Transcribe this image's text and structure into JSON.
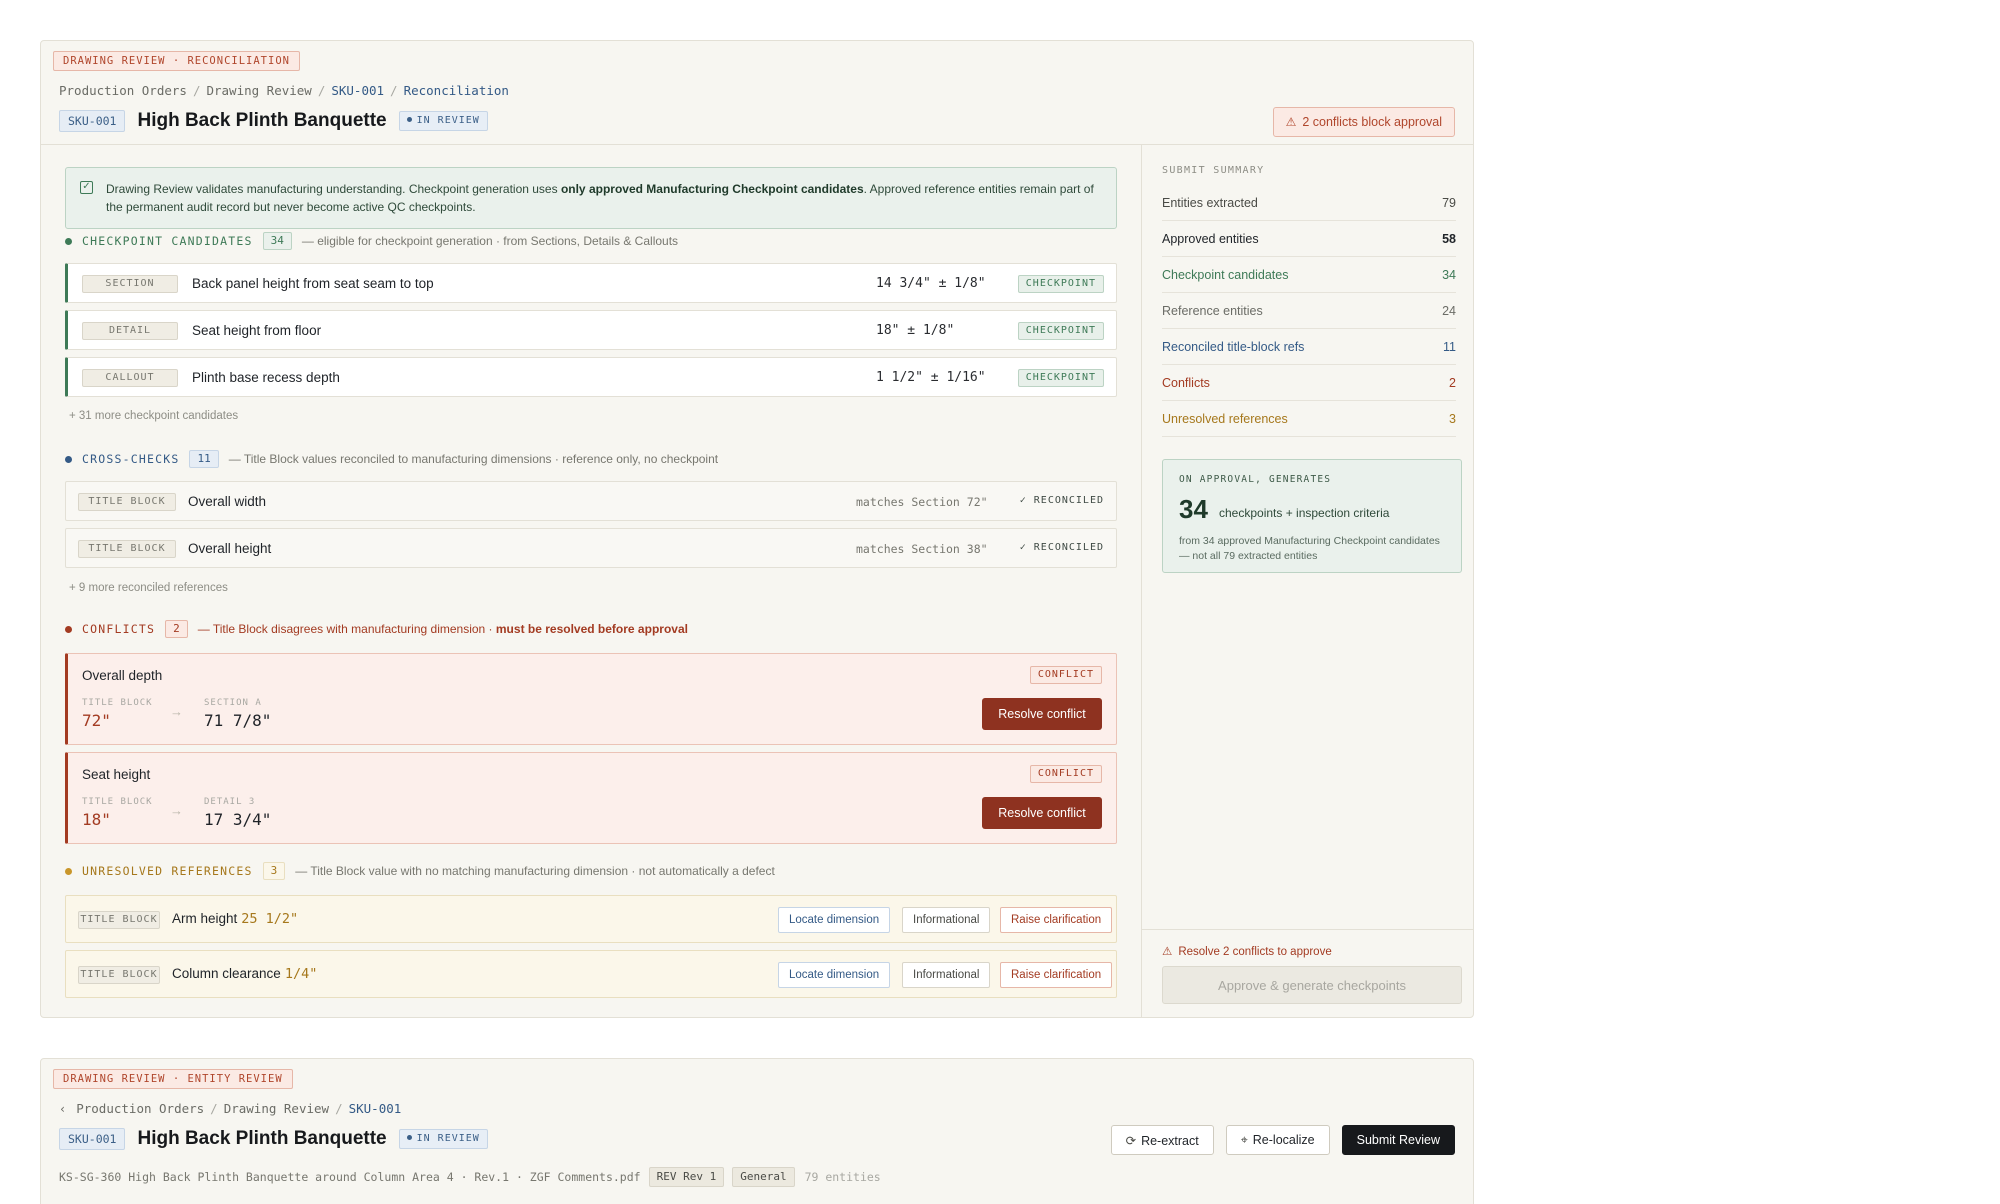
{
  "panel1": {
    "ribbon": "DRAWING REVIEW · RECONCILIATION",
    "breadcrumb": [
      "Production Orders",
      "Drawing Review",
      "SKU-001",
      "Reconciliation"
    ],
    "sku": "SKU-001",
    "title": "High Back Plinth Banquette",
    "status": "IN REVIEW",
    "blocker": "2 conflicts block approval",
    "note": {
      "pre": "Drawing Review validates manufacturing understanding. Checkpoint generation uses ",
      "bold": "only approved Manufacturing Checkpoint candidates",
      "post": ". Approved reference entities remain part of the permanent audit record but never become active QC checkpoints."
    },
    "candidates": {
      "title": "CHECKPOINT CANDIDATES",
      "count": "34",
      "desc": "— eligible for checkpoint generation · from Sections, Details & Callouts",
      "rows": [
        {
          "tag": "SECTION",
          "label": "Back panel height from seat seam to top",
          "value": "14 3/4\" ± 1/8\"",
          "badge": "CHECKPOINT"
        },
        {
          "tag": "DETAIL",
          "label": "Seat height from floor",
          "value": "18\" ± 1/8\"",
          "badge": "CHECKPOINT"
        },
        {
          "tag": "CALLOUT",
          "label": "Plinth base recess depth",
          "value": "1 1/2\" ± 1/16\"",
          "badge": "CHECKPOINT"
        }
      ],
      "more": "+ 31 more checkpoint candidates"
    },
    "crosschecks": {
      "title": "CROSS-CHECKS",
      "count": "11",
      "desc": "— Title Block values reconciled to manufacturing dimensions · reference only, no checkpoint",
      "rows": [
        {
          "tag": "TITLE BLOCK",
          "label": "Overall width",
          "match": "matches Section 72\"",
          "status": "✓ RECONCILED"
        },
        {
          "tag": "TITLE BLOCK",
          "label": "Overall height",
          "match": "matches Section 38\"",
          "status": "✓ RECONCILED"
        }
      ],
      "more": "+ 9 more reconciled references"
    },
    "conflicts": {
      "title": "CONFLICTS",
      "count": "2",
      "desc": "— Title Block disagrees with manufacturing dimension · ",
      "desc_bold": "must be resolved before approval",
      "items": [
        {
          "name": "Overall depth",
          "badge": "CONFLICT",
          "from_label": "TITLE BLOCK",
          "from_value": "72\"",
          "to_label": "SECTION A",
          "to_value": "71 7/8\"",
          "action": "Resolve conflict"
        },
        {
          "name": "Seat height",
          "badge": "CONFLICT",
          "from_label": "TITLE BLOCK",
          "from_value": "18\"",
          "to_label": "DETAIL 3",
          "to_value": "17 3/4\"",
          "action": "Resolve conflict"
        }
      ]
    },
    "unresolved": {
      "title": "UNRESOLVED REFERENCES",
      "count": "3",
      "desc": "— Title Block value with no matching manufacturing dimension · not automatically a defect",
      "rows": [
        {
          "tag": "TITLE BLOCK",
          "label": "Arm height",
          "value": "25 1/2\""
        },
        {
          "tag": "TITLE BLOCK",
          "label": "Column clearance",
          "value": "1/4\""
        }
      ],
      "actions": {
        "locate": "Locate dimension",
        "info": "Informational",
        "raise": "Raise clarification"
      }
    },
    "summary": {
      "heading": "SUBMIT SUMMARY",
      "rows": [
        {
          "label": "Entities extracted",
          "value": "79"
        },
        {
          "label": "Approved entities",
          "value": "58"
        },
        {
          "label": "Checkpoint candidates",
          "value": "34"
        },
        {
          "label": "Reference entities",
          "value": "24"
        },
        {
          "label": "Reconciled title-block refs",
          "value": "11"
        },
        {
          "label": "Conflicts",
          "value": "2"
        },
        {
          "label": "Unresolved references",
          "value": "3"
        }
      ],
      "generates": {
        "heading": "ON APPROVAL, GENERATES",
        "number": "34",
        "text": "checkpoints + inspection criteria",
        "detail": "from 34 approved Manufacturing Checkpoint candidates — not all 79 extracted entities"
      },
      "warning": "Resolve 2 conflicts to approve",
      "approve": "Approve & generate checkpoints"
    }
  },
  "panel2": {
    "ribbon": "DRAWING REVIEW · ENTITY REVIEW",
    "breadcrumb": [
      "Production Orders",
      "Drawing Review",
      "SKU-001"
    ],
    "sku": "SKU-001",
    "title": "High Back Plinth Banquette",
    "status": "IN REVIEW",
    "reextract": "Re-extract",
    "relocalize": "Re-localize",
    "submit": "Submit Review",
    "file": "KS-SG-360 High Back Plinth Banquette around Column Area 4 · Rev.1 · ZGF Comments.pdf",
    "rev": "REV Rev 1",
    "category": "General",
    "entities": "79 entities"
  },
  "colors": {
    "checkpoint_green": "#3e7a57",
    "crosscheck_blue": "#345a86",
    "conflict_red": "#a33b22",
    "unresolved_amber": "#c9962a"
  }
}
